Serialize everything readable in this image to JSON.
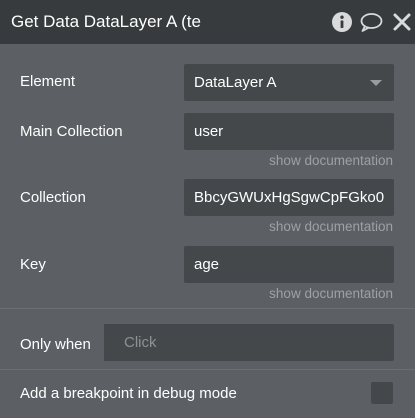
{
  "titlebar": {
    "title": "Get Data DataLayer A (te",
    "icons": [
      "info-icon",
      "comment-icon",
      "close-icon"
    ]
  },
  "fields": {
    "element": {
      "label": "Element",
      "value": "DataLayer A"
    },
    "main_collection": {
      "label": "Main Collection",
      "value": "user",
      "doc": "show documentation"
    },
    "collection": {
      "label": "Collection",
      "value": "BbcyGWUxHgSgwCpFGko0",
      "doc": "show documentation"
    },
    "key": {
      "label": "Key",
      "value": "age",
      "doc": "show documentation"
    }
  },
  "only_when": {
    "label": "Only when",
    "placeholder": "Click"
  },
  "breakpoint": {
    "label": "Add a breakpoint in debug mode",
    "checked": false
  },
  "colors": {
    "titlebar_bg": "#373b3e",
    "panel_bg": "#5c6064",
    "field_bg": "#44484b",
    "muted_text": "#9ea1a4"
  }
}
